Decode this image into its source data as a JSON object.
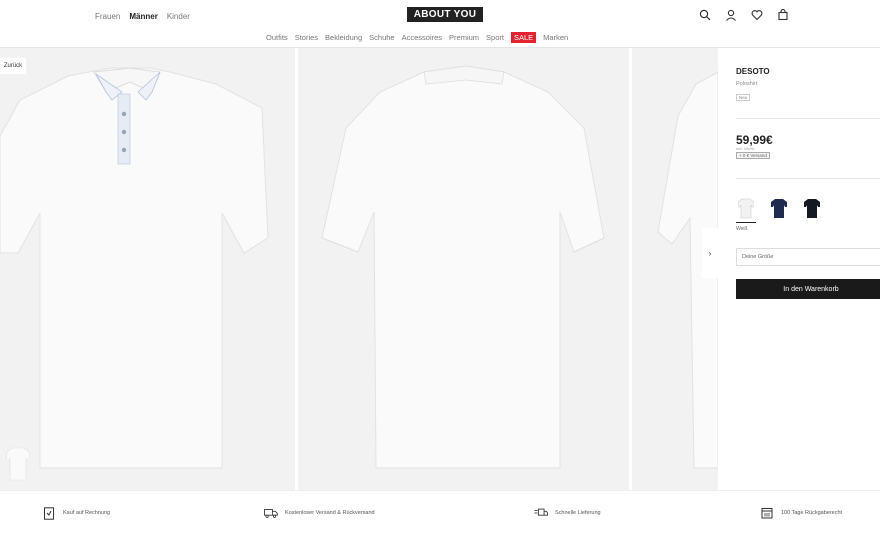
{
  "header": {
    "gender_nav": [
      "Frauen",
      "Männer",
      "Kinder"
    ],
    "logo": "ABOUT YOU",
    "categories": [
      "Outfits",
      "Stories",
      "Bekleidung",
      "Schuhe",
      "Accessoires",
      "Premium",
      "Sport",
      "SALE",
      "Marken"
    ]
  },
  "gallery": {
    "back_label": "Zurück",
    "next_arrow": "›"
  },
  "product": {
    "brand": "DESOTO",
    "type": "Poloshirt",
    "tag": "Neu",
    "price": "59,99€",
    "vat_note": "inkl. MwSt.",
    "shipping_badge": "+ 0 € Versand",
    "selected_color": "Weiß",
    "colors": [
      {
        "name": "white",
        "hex": "#f2f2f2"
      },
      {
        "name": "navy",
        "hex": "#1f2c4f"
      },
      {
        "name": "black",
        "hex": "#151a22"
      }
    ],
    "size_placeholder": "Deine Größe",
    "cart_label": "In den Warenkorb"
  },
  "features": [
    {
      "icon": "invoice-icon",
      "label": "Kauf auf Rechnung"
    },
    {
      "icon": "truck-icon",
      "label": "Kostenloser Versand & Rückversand"
    },
    {
      "icon": "fast-delivery-icon",
      "label": "Schnelle Lieferung"
    },
    {
      "icon": "calendar-icon",
      "label": "100 Tage Rückgaberecht"
    }
  ],
  "colors": {
    "sale": "#e3232f",
    "button": "#1a1a1a",
    "gallery_bg": "#f2f2f2"
  }
}
